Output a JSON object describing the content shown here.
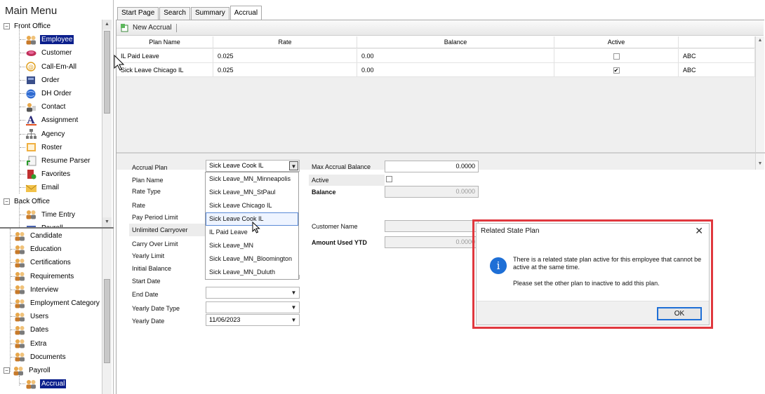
{
  "left_panel": {
    "title": "Main Menu",
    "top_tree": [
      {
        "label": "Front Office",
        "icon": "folder-minus-icon",
        "level": 0
      },
      {
        "label": "Employee",
        "icon": "people-icon",
        "level": 1,
        "selected": true
      },
      {
        "label": "Customer",
        "icon": "customer-icon",
        "level": 1
      },
      {
        "label": "Call-Em-All",
        "icon": "phone-icon",
        "level": 1
      },
      {
        "label": "Order",
        "icon": "order-icon",
        "level": 1
      },
      {
        "label": "DH Order",
        "icon": "globe-icon",
        "level": 1
      },
      {
        "label": "Contact",
        "icon": "contact-icon",
        "level": 1
      },
      {
        "label": "Assignment",
        "icon": "letter-a-icon",
        "level": 1
      },
      {
        "label": "Agency",
        "icon": "org-chart-icon",
        "level": 1
      },
      {
        "label": "Roster",
        "icon": "roster-icon",
        "level": 1
      },
      {
        "label": "Resume Parser",
        "icon": "resume-icon",
        "level": 1
      },
      {
        "label": "Favorites",
        "icon": "favorites-icon",
        "level": 1
      },
      {
        "label": "Email",
        "icon": "email-icon",
        "level": 1
      },
      {
        "label": "Back Office",
        "icon": "folder-minus-icon",
        "level": 0
      },
      {
        "label": "Time Entry",
        "icon": "people-icon",
        "level": 1
      },
      {
        "label": "Payroll",
        "icon": "payroll-icon",
        "level": 1
      }
    ],
    "bottom_tree": [
      {
        "label": "Candidate",
        "level": 1
      },
      {
        "label": "Education",
        "level": 1
      },
      {
        "label": "Certifications",
        "level": 1
      },
      {
        "label": "Requirements",
        "level": 1
      },
      {
        "label": "Interview",
        "level": 1
      },
      {
        "label": "Employment Category",
        "level": 1
      },
      {
        "label": "Users",
        "level": 1
      },
      {
        "label": "Dates",
        "level": 1
      },
      {
        "label": "Extra",
        "level": 1
      },
      {
        "label": "Documents",
        "level": 1
      },
      {
        "label": "Payroll",
        "level": 0
      },
      {
        "label": "Accrual",
        "level": 1,
        "selected": true
      }
    ]
  },
  "tabs": [
    {
      "label": "Start Page"
    },
    {
      "label": "Search"
    },
    {
      "label": "Summary"
    },
    {
      "label": "Accrual",
      "active": true
    }
  ],
  "toolbar": {
    "new_accrual": "New Accrual"
  },
  "grid": {
    "columns": [
      "Plan Name",
      "Rate",
      "Balance",
      "Active",
      ""
    ],
    "rows": [
      {
        "plan_name": "IL Paid Leave",
        "rate": "0.025",
        "balance": "0.00",
        "active": false,
        "extra": "ABC"
      },
      {
        "plan_name": "Sick Leave Chicago IL",
        "rate": "0.025",
        "balance": "0.00",
        "active": true,
        "extra": "ABC"
      }
    ]
  },
  "form": {
    "labels": {
      "accrual_plan": "Accrual Plan",
      "plan_name": "Plan Name",
      "rate_type": "Rate Type",
      "rate": "Rate",
      "pay_period_limit": "Pay Period Limit",
      "unlimited_carryover": "Unlimited Carryover",
      "carry_over_limit": "Carry Over Limit",
      "yearly_limit": "Yearly Limit",
      "initial_balance": "Initial Balance",
      "start_date": "Start Date",
      "end_date": "End Date",
      "yearly_date_type": "Yearly Date Type",
      "yearly_date": "Yearly Date",
      "max_accrual_balance": "Max Accrual Balance",
      "active": "Active",
      "balance": "Balance",
      "customer_name": "Customer Name",
      "amount_used_ytd": "Amount Used YTD"
    },
    "accrual_plan_value": "Sick Leave Cook IL",
    "yearly_date_value": "11/06/2023",
    "max_accrual_balance_value": "0.0000",
    "balance_value": "0.0000",
    "amount_used_ytd_value": "0.0000",
    "dropdown_options": [
      "Sick Leave_MN_Minneapolis",
      "Sick Leave_MN_StPaul",
      "Sick Leave Chicago IL",
      "Sick Leave Cook IL",
      "IL Paid Leave",
      "Sick Leave_MN",
      "Sick Leave_MN_Bloomington",
      "Sick Leave_MN_Duluth"
    ]
  },
  "dialog": {
    "title": "Related State Plan",
    "message1": "There is a related state plan active for this employee that cannot be active at the same time.",
    "message2": "Please set the other plan to inactive to add this plan.",
    "ok_label": "OK"
  },
  "colors": {
    "selection": "#0b1f8c",
    "dialog_highlight": "#e0383e",
    "info_blue": "#1e6fd6"
  }
}
